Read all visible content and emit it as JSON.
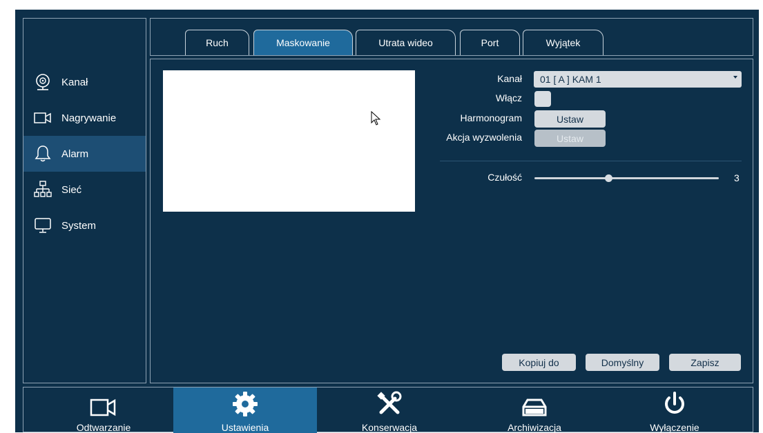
{
  "sidebar": {
    "items": [
      {
        "label": "Kanał",
        "icon": "camera-lens-icon",
        "active": false
      },
      {
        "label": "Nagrywanie",
        "icon": "video-camera-icon",
        "active": false
      },
      {
        "label": "Alarm",
        "icon": "bell-icon",
        "active": true
      },
      {
        "label": "Sieć",
        "icon": "network-icon",
        "active": false
      },
      {
        "label": "System",
        "icon": "monitor-icon",
        "active": false
      }
    ]
  },
  "tabs": [
    {
      "label": "Ruch",
      "active": false
    },
    {
      "label": "Maskowanie",
      "active": true
    },
    {
      "label": "Utrata wideo",
      "active": false
    },
    {
      "label": "Port",
      "active": false
    },
    {
      "label": "Wyjątek",
      "active": false
    }
  ],
  "form": {
    "channel_label": "Kanał",
    "channel_value": "01 [ A ] KAM 1",
    "enable_label": "Włącz",
    "enable_checked": false,
    "schedule_label": "Harmonogram",
    "schedule_button": "Ustaw",
    "trigger_label": "Akcja wyzwolenia",
    "trigger_button": "Ustaw",
    "sensitivity_label": "Czułość",
    "sensitivity_value": "3",
    "sensitivity_fraction": 0.4
  },
  "actions": {
    "copy": "Kopiuj do",
    "default": "Domyślny",
    "save": "Zapisz"
  },
  "bottombar": {
    "items": [
      {
        "label": "Odtwarzanie",
        "icon": "video-camera-icon",
        "active": false
      },
      {
        "label": "Ustawienia",
        "icon": "gear-icon",
        "active": true
      },
      {
        "label": "Konserwacja",
        "icon": "tools-icon",
        "active": false
      },
      {
        "label": "Archiwizacja",
        "icon": "archive-tray-icon",
        "active": false
      },
      {
        "label": "Wyłączenie",
        "icon": "power-icon",
        "active": false
      }
    ]
  },
  "colors": {
    "background": "#0d304a",
    "active_sidebar": "#1d4e74",
    "active_accent": "#1f6a9c",
    "button": "#d4d9de"
  }
}
